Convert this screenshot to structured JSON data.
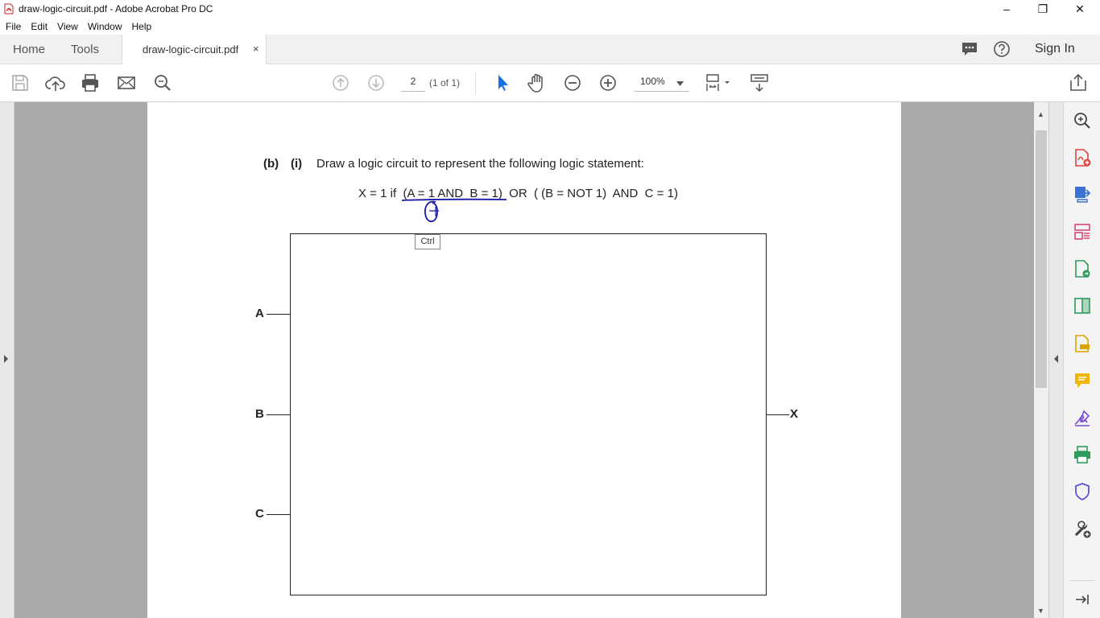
{
  "window": {
    "title": "draw-logic-circuit.pdf - Adobe Acrobat Pro DC",
    "controls": {
      "minimize": "–",
      "restore": "❐",
      "close": "✕"
    }
  },
  "menu": [
    "File",
    "Edit",
    "View",
    "Window",
    "Help"
  ],
  "tabs": {
    "home": "Home",
    "tools": "Tools",
    "document": "draw-logic-circuit.pdf",
    "close": "×",
    "sign_in": "Sign In"
  },
  "toolbar": {
    "page_number": "2",
    "page_of": "(1 of 1)",
    "zoom": "100%"
  },
  "document": {
    "part_label": "(b)",
    "sub_label": "(i)",
    "instruction": "Draw a logic circuit to represent the following logic statement:",
    "statement": "X = 1 if  (A = 1 AND  B = 1)  OR  ( (B = NOT 1)  AND  C = 1)",
    "inputs": [
      "A",
      "B",
      "C"
    ],
    "output": "X",
    "tooltip": "Ctrl"
  },
  "colors": {
    "accent": "#1473e6",
    "ink": "#1a1aa8",
    "page": "#ffffff",
    "canvas": "#a9a9a9"
  }
}
